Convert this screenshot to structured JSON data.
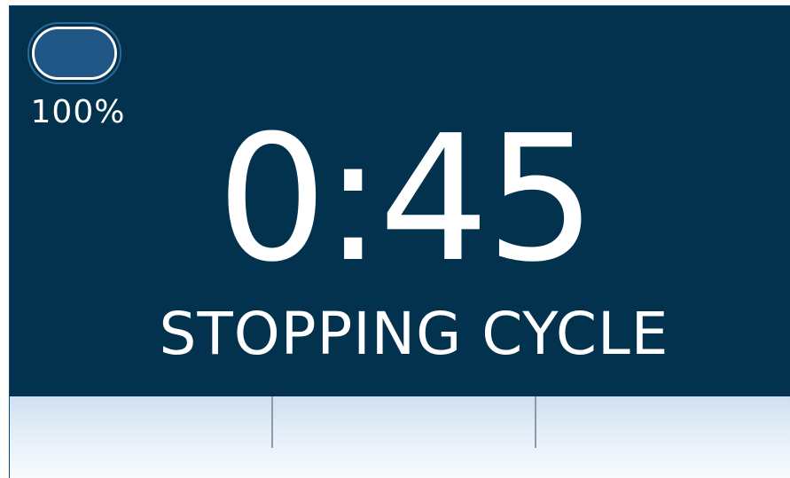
{
  "display": {
    "level_percent": 100,
    "level_label": "100%",
    "timer": "0:45",
    "status": "STOPPING CYCLE"
  },
  "soft_buttons": [
    {
      "label": ""
    },
    {
      "label": ""
    },
    {
      "label": ""
    }
  ],
  "colors": {
    "screen_background": "#03324f",
    "text": "#ffffff",
    "indicator_fill": "#1f5685",
    "button_bar_top": "#cfe0f0",
    "button_bar_bottom": "#f7fafd"
  }
}
